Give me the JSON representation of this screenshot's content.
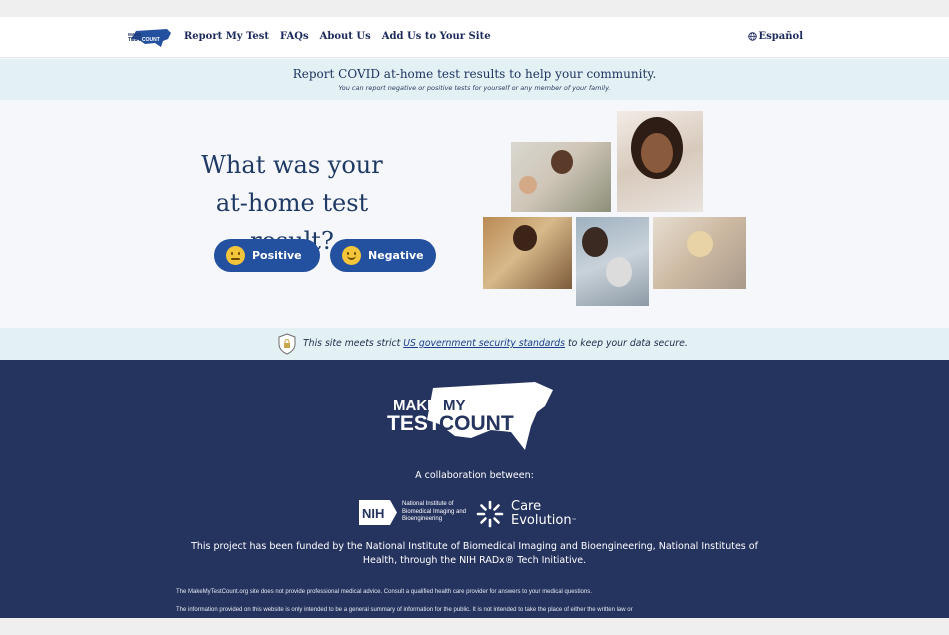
{
  "header": {
    "logo_alt": "Make My Test Count",
    "nav": [
      "Report My Test",
      "FAQs",
      "About Us",
      "Add Us to Your Site"
    ],
    "language_label": "Español"
  },
  "notice": {
    "title": "Report COVID at-home test results to help your community.",
    "subtitle": "You can report negative or positive tests for yourself or any member of your family."
  },
  "hero": {
    "title_line1": "What was your",
    "title_line2": "at-home test result?",
    "positive_label": "Positive",
    "negative_label": "Negative"
  },
  "security": {
    "text_before": "This site meets strict ",
    "link_text": "US government security standards",
    "text_after": " to keep your data secure."
  },
  "footer": {
    "logo_make": "MAKE",
    "logo_my": "MY",
    "logo_test": "TEST",
    "logo_count": "COUNT",
    "collab_label": "A collaboration between:",
    "nih_abbr": "NIH",
    "nih_name": "National Institute of Biomedical Imaging and Bioengineering",
    "care_line1": "Care",
    "care_line2": "Evolution",
    "care_tm": "™",
    "funding": "This project has been funded by the National Institute of Biomedical Imaging and Bioengineering, National Institutes of Health, through the NIH RADx® Tech Initiative.",
    "disclaimer1": "The MakeMyTestCount.org site does not provide professional medical advice. Consult a qualified health care provider for answers to your medical questions.",
    "disclaimer2": "The information provided on this website is only intended to be a general summary of information for the public.  It is not intended to take the place of either the written law or"
  },
  "colors": {
    "navy": "#1b2a5a",
    "button_blue": "#2450a0",
    "footer_bg": "#25335f",
    "banner_bg": "#e3f0f4"
  },
  "icons": [
    "globe-icon",
    "positive-face-icon",
    "negative-face-icon",
    "lock-shield-icon",
    "nih-logo-icon",
    "care-evolution-logo-icon"
  ]
}
